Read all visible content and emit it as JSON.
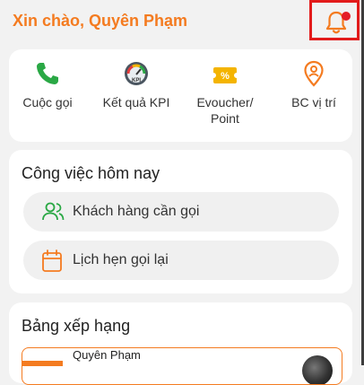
{
  "header": {
    "greeting": "Xin chào, Quyên Phạm",
    "notification_icon": "bell-icon"
  },
  "quick_actions": [
    {
      "label": "Cuộc gọi",
      "icon": "phone-icon"
    },
    {
      "label": "Kết quả KPI",
      "icon": "kpi-gauge-icon"
    },
    {
      "label": "Evoucher/\nPoint",
      "icon": "voucher-icon"
    },
    {
      "label": "BC vị trí",
      "icon": "location-pin-icon"
    }
  ],
  "today_work": {
    "title": "Công việc hôm nay",
    "items": [
      {
        "label": "Khách hàng cần gọi",
        "icon": "customers-icon"
      },
      {
        "label": "Lịch hẹn gọi lại",
        "icon": "calendar-icon"
      }
    ]
  },
  "ranking": {
    "title": "Bảng xếp hạng",
    "top_name": "Quyên Phạm"
  },
  "colors": {
    "accent": "#f47b20",
    "phone_green": "#2aa845",
    "alert_red": "#e41e26"
  }
}
